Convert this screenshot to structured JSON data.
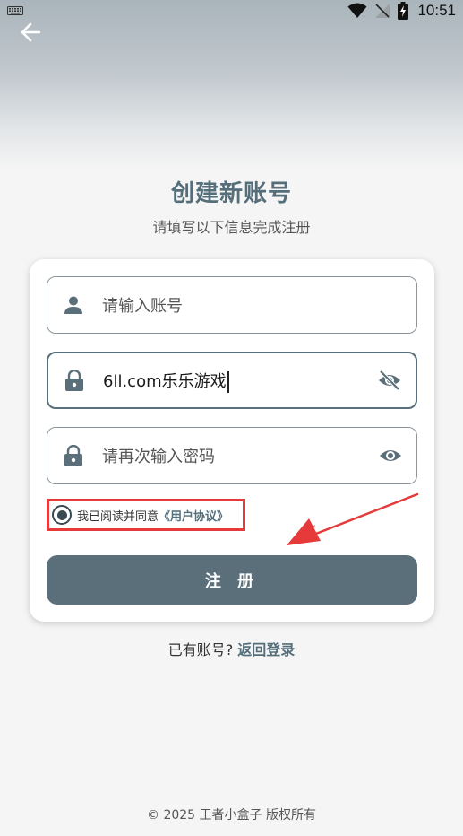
{
  "status_bar": {
    "time": "10:51",
    "icons": [
      "keyboard-icon",
      "wifi-icon",
      "no-signal-icon",
      "battery-charging-icon"
    ]
  },
  "header": {
    "back_icon": "arrow-left-icon"
  },
  "page": {
    "title": "创建新账号",
    "subtitle": "请填写以下信息完成注册"
  },
  "form": {
    "account": {
      "placeholder": "请输入账号",
      "icon": "person-icon"
    },
    "password": {
      "value": "6ll.com乐乐游戏",
      "icon": "lock-icon",
      "toggle_icon": "eye-off-icon"
    },
    "confirm_password": {
      "placeholder": "请再次输入密码",
      "icon": "lock-icon",
      "toggle_icon": "eye-icon"
    },
    "agreement": {
      "text": "我已阅读并同意",
      "link": "《用户协议》",
      "checked": true
    },
    "submit_label": "注 册"
  },
  "login_prompt": {
    "question": "已有账号?",
    "link": "返回登录"
  },
  "footer": {
    "copyright": "© 2025 王者小盒子 版权所有"
  },
  "colors": {
    "accent": "#5a6f7a",
    "title": "#546e7a",
    "annotation": "#e5393a"
  }
}
